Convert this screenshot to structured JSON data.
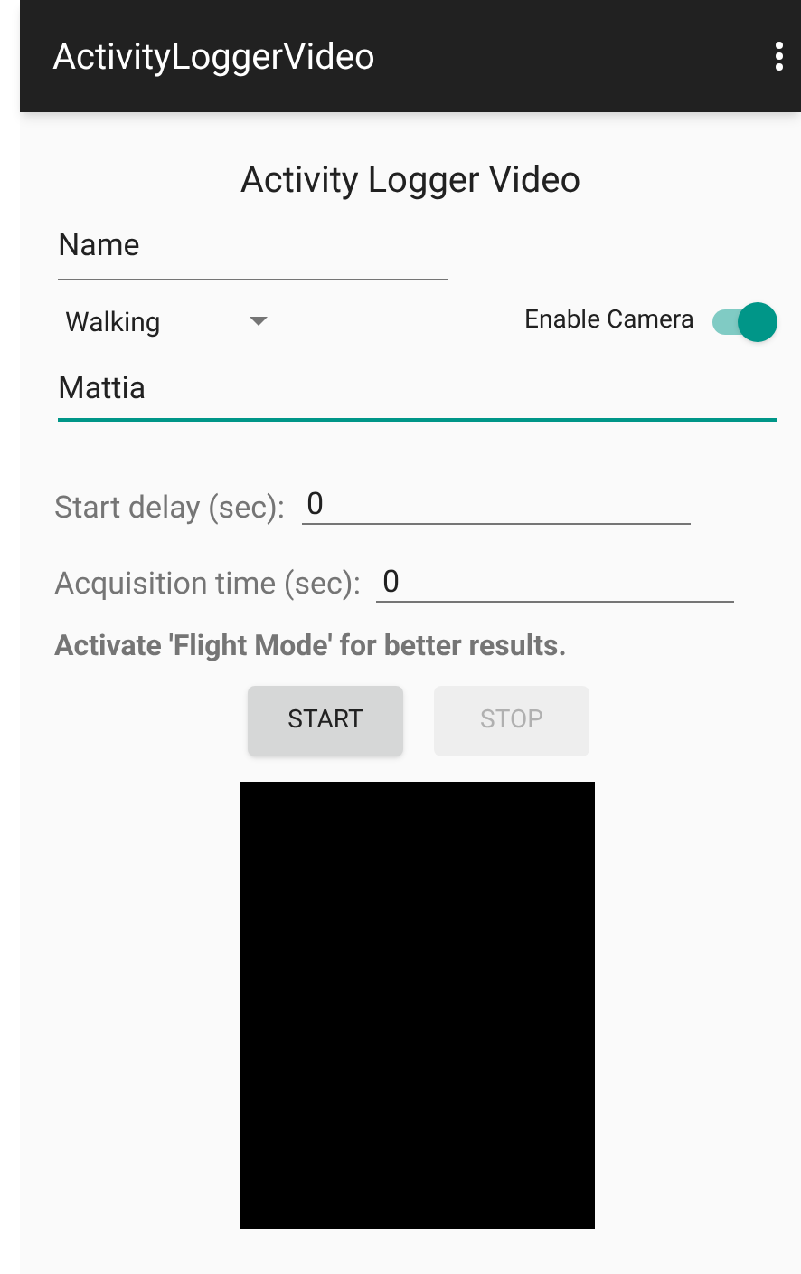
{
  "app_bar": {
    "title": "ActivityLoggerVideo"
  },
  "heading": "Activity Logger Video",
  "name_field": {
    "value": "Name",
    "focused": false
  },
  "activity_spinner": {
    "value": "Walking"
  },
  "camera_switch": {
    "label": "Enable Camera",
    "on": true
  },
  "user_field": {
    "value": "Mattia",
    "focused": true
  },
  "start_delay": {
    "label": "Start delay (sec):",
    "value": "0"
  },
  "acquisition_time": {
    "label": "Acquisition time (sec):",
    "value": "0"
  },
  "hint": "Activate 'Flight Mode' for better results.",
  "buttons": [
    {
      "label": "START",
      "disabled": false
    },
    {
      "label": "STOP",
      "disabled": true
    }
  ]
}
